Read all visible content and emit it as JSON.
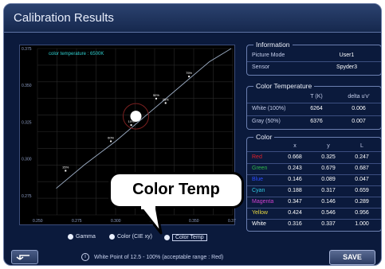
{
  "window": {
    "title": "Calibration Results"
  },
  "graph": {
    "legend_text": "color temperature : 6500K",
    "y_ticks": [
      "0.375",
      "0.350",
      "0.325",
      "0.300",
      "0.275"
    ],
    "x_ticks": [
      "0.250",
      "0.275",
      "0.300",
      "0.325",
      "0.350",
      "0.375"
    ],
    "point_labels": [
      "100",
      "75%",
      "50%",
      "25%",
      "10%",
      "60%",
      "35%"
    ]
  },
  "chart_data": {
    "type": "scatter",
    "title": "color temperature : 6500K",
    "xlim": [
      0.25,
      0.375
    ],
    "ylim": [
      0.262,
      0.375
    ],
    "x_ticks": [
      0.25,
      0.275,
      0.3,
      0.325,
      0.35,
      0.375
    ],
    "y_ticks": [
      0.375,
      0.35,
      0.325,
      0.3,
      0.275
    ],
    "series": [
      {
        "points": [
          {
            "x": 0.313,
            "y": 0.329,
            "label": ""
          },
          {
            "x": 0.313,
            "y": 0.329,
            "label": "100"
          },
          {
            "x": 0.347,
            "y": 0.356,
            "label": "75%"
          },
          {
            "x": 0.326,
            "y": 0.341,
            "label": "50%"
          },
          {
            "x": 0.332,
            "y": 0.338,
            "label": "25%"
          },
          {
            "x": 0.31,
            "y": 0.323,
            "label": "10%"
          },
          {
            "x": 0.297,
            "y": 0.312,
            "label": "60%"
          },
          {
            "x": 0.268,
            "y": 0.292,
            "label": "35%"
          }
        ]
      }
    ],
    "curve": [
      [
        0.262,
        0.28
      ],
      [
        0.28,
        0.296
      ],
      [
        0.3,
        0.312
      ],
      [
        0.32,
        0.33
      ],
      [
        0.34,
        0.348
      ],
      [
        0.36,
        0.366
      ],
      [
        0.374,
        0.375
      ]
    ],
    "grid": true
  },
  "graph_mode": {
    "options": [
      "Gamma",
      "Color (CIE xy)",
      "Color Temp"
    ],
    "selected": "Color Temp"
  },
  "information": {
    "title": "Information",
    "picture_mode_label": "Picture Mode",
    "picture_mode_value": "User1",
    "sensor_label": "Sensor",
    "sensor_value": "Spyder3"
  },
  "color_temperature": {
    "title": "Color Temperature",
    "headers": [
      "T (K)",
      "delta u'v'"
    ],
    "rows": [
      {
        "name": "White (100%)",
        "t": "6264",
        "delta": "0.006"
      },
      {
        "name": "Gray (50%)",
        "t": "6376",
        "delta": "0.007"
      }
    ]
  },
  "color": {
    "title": "Color",
    "headers": [
      "x",
      "y",
      "L"
    ],
    "rows": [
      {
        "name": "Red",
        "color": "#e0202a",
        "x": "0.668",
        "y": "0.325",
        "l": "0.247"
      },
      {
        "name": "Green",
        "color": "#2fb84a",
        "x": "0.243",
        "y": "0.679",
        "l": "0.687"
      },
      {
        "name": "Blue",
        "color": "#2a4cff",
        "x": "0.146",
        "y": "0.089",
        "l": "0.047"
      },
      {
        "name": "Cyan",
        "color": "#30c8e0",
        "x": "0.188",
        "y": "0.317",
        "l": "0.659"
      },
      {
        "name": "Magenta",
        "color": "#d040d0",
        "x": "0.347",
        "y": "0.146",
        "l": "0.289"
      },
      {
        "name": "Yellow",
        "color": "#e8d840",
        "x": "0.424",
        "y": "0.546",
        "l": "0.956"
      },
      {
        "name": "White",
        "color": "#ffffff",
        "x": "0.316",
        "y": "0.337",
        "l": "1.000"
      }
    ]
  },
  "footer": {
    "note": "White Point of 12.5 - 100% (acceptable range : Red)",
    "save_label": "SAVE",
    "info_icon": "i"
  },
  "callout": {
    "text": "Color Temp"
  },
  "colors": {
    "background": "#0b1a3c",
    "accent": "#6b7fb0",
    "legend_text": "#2fd0d0",
    "grid": "#2a2a2a",
    "curve": "#9fb0c8"
  }
}
